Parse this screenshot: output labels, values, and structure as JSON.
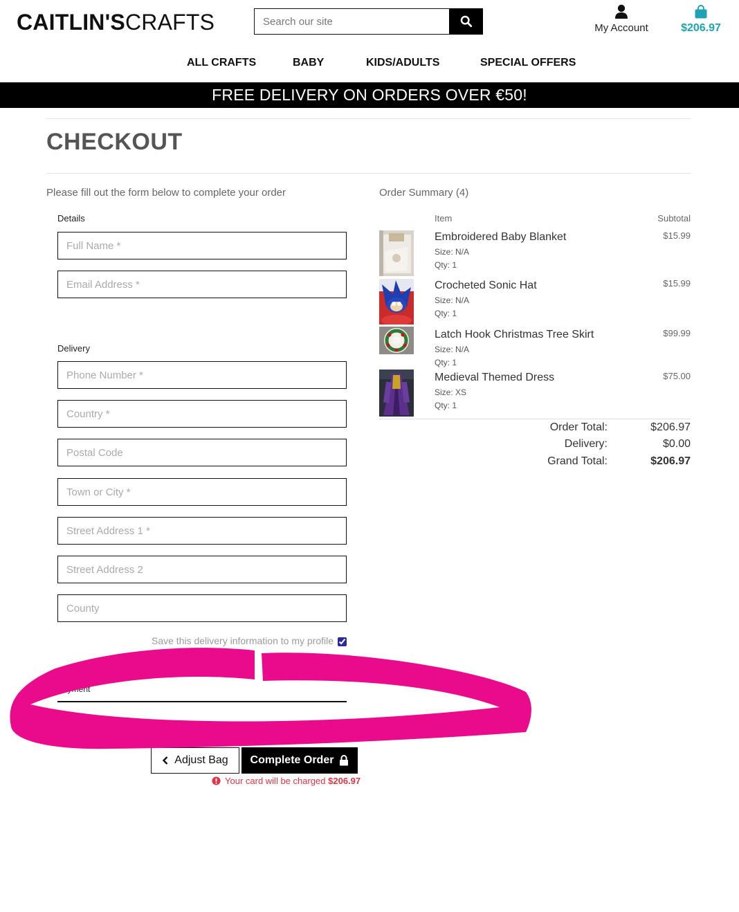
{
  "header": {
    "logo_bold": "CAITLIN'S",
    "logo_light": "CRAFTS",
    "search_placeholder": "Search our site",
    "account_label": "My Account",
    "bag_total": "$206.97"
  },
  "nav": {
    "items": [
      {
        "label": "ALL CRAFTS"
      },
      {
        "label": "BABY"
      },
      {
        "label": "KIDS/ADULTS"
      },
      {
        "label": "SPECIAL OFFERS"
      }
    ]
  },
  "banner": {
    "text": "FREE DELIVERY ON ORDERS OVER €50!"
  },
  "page": {
    "title": "CHECKOUT",
    "intro": "Please fill out the form below to complete your order"
  },
  "form": {
    "details_label": "Details",
    "delivery_label": "Delivery",
    "payment_label": "Payment",
    "fields": {
      "full_name": "Full Name *",
      "email": "Email Address *",
      "phone": "Phone Number *",
      "country": "Country *",
      "postcode": "Postal Code",
      "town": "Town or City *",
      "street1": "Street Address 1 *",
      "street2": "Street Address 2",
      "county": "County"
    },
    "save_info_label": "Save this delivery information to my profile",
    "adjust_bag_label": "Adjust Bag",
    "complete_order_label": "Complete Order",
    "charge_note_prefix": "Your card will be charged",
    "charge_amount": "$206.97"
  },
  "summary": {
    "title": "Order Summary (4)",
    "col_item": "Item",
    "col_subtotal": "Subtotal",
    "items": [
      {
        "name": "Embroidered Baby Blanket",
        "size": "Size: N/A",
        "qty": "Qty: 1",
        "price": "$15.99"
      },
      {
        "name": "Crocheted Sonic Hat",
        "size": "Size: N/A",
        "qty": "Qty: 1",
        "price": "$15.99"
      },
      {
        "name": "Latch Hook Christmas Tree Skirt",
        "size": "Size: N/A",
        "qty": "Qty: 1",
        "price": "$99.99"
      },
      {
        "name": "Medieval Themed Dress",
        "size": "Size: XS",
        "qty": "Qty: 1",
        "price": "$75.00"
      }
    ],
    "order_total_label": "Order Total:",
    "order_total": "$206.97",
    "delivery_label": "Delivery:",
    "delivery": "$0.00",
    "grand_total_label": "Grand Total:",
    "grand_total": "$206.97"
  },
  "colors": {
    "accent": "#1fa2b3",
    "error": "#dc3545",
    "annotation": "#ea0a8c"
  }
}
